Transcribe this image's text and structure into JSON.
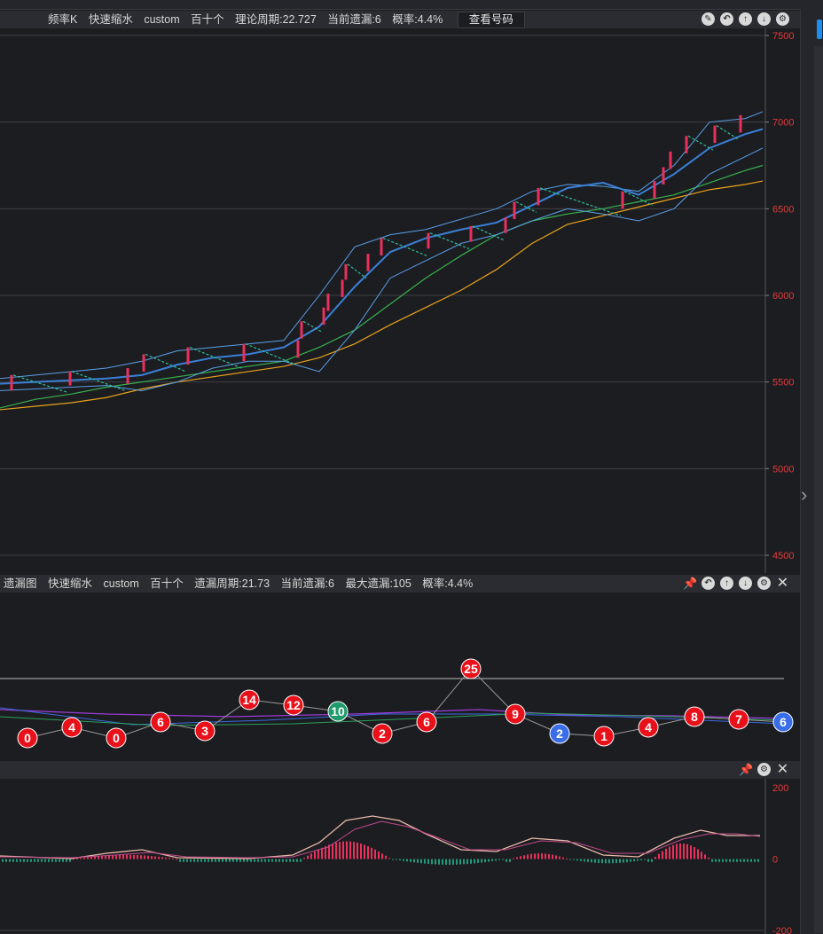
{
  "colors": {
    "bg": "#1c1d21",
    "bar": "#2b2c31",
    "up": "#e8315c",
    "axis": "#e23b3b",
    "boll": "#5aa0e8",
    "mid": "#3a80d8",
    "ma1": "#37b24d",
    "ma2": "#e8a21a",
    "bubble_red": "#e8111a",
    "bubble_blue": "#3a6ee8",
    "bubble_green": "#1f9a6a"
  },
  "top_bar": {
    "items": [
      "频率K",
      "快速缩水",
      "custom",
      "百十个",
      "理论周期:22.727",
      "当前遗漏:6",
      "概率:4.4%"
    ],
    "button": "查看号码",
    "icons": [
      "edit-icon",
      "undo-icon",
      "up-icon",
      "down-icon",
      "settings-icon"
    ]
  },
  "mid_bar": {
    "items": [
      "遗漏图",
      "快速缩水",
      "custom",
      "百十个",
      "遗漏周期:21.73",
      "当前遗漏:6",
      "最大遗漏:105",
      "概率:4.4%"
    ],
    "icons": [
      "pin-icon",
      "undo-icon",
      "up-icon",
      "down-icon",
      "settings-icon",
      "close-icon"
    ]
  },
  "bot_bar": {
    "icons": [
      "pin-icon",
      "settings-icon",
      "close-icon"
    ]
  },
  "chart_data": [
    {
      "type": "line",
      "name": "price",
      "y_ticks": [
        7500,
        7000,
        6500,
        6000,
        5500,
        5000,
        4500
      ],
      "ylim": [
        4500,
        7500
      ],
      "x": [
        0,
        40,
        80,
        120,
        160,
        200,
        240,
        280,
        320,
        360,
        400,
        440,
        480,
        520,
        560,
        600,
        640,
        680,
        720,
        760,
        800,
        840,
        860
      ],
      "mid": [
        5490,
        5500,
        5510,
        5520,
        5540,
        5600,
        5640,
        5660,
        5700,
        5820,
        6050,
        6250,
        6330,
        6380,
        6420,
        6520,
        6620,
        6650,
        6580,
        6700,
        6850,
        6930,
        6960
      ],
      "upper": [
        5520,
        5540,
        5560,
        5580,
        5620,
        5680,
        5700,
        5720,
        5740,
        6000,
        6280,
        6350,
        6380,
        6440,
        6500,
        6600,
        6640,
        6630,
        6600,
        6750,
        7000,
        7020,
        7060
      ],
      "lower": [
        5450,
        5460,
        5470,
        5480,
        5450,
        5500,
        5580,
        5620,
        5620,
        5560,
        5800,
        6100,
        6200,
        6300,
        6350,
        6430,
        6500,
        6470,
        6430,
        6500,
        6700,
        6800,
        6850
      ],
      "ma_green": [
        5350,
        5400,
        5430,
        5470,
        5500,
        5530,
        5560,
        5590,
        5620,
        5700,
        5800,
        5950,
        6100,
        6230,
        6350,
        6430,
        6470,
        6500,
        6540,
        6580,
        6650,
        6720,
        6750
      ],
      "ma_orange": [
        5340,
        5360,
        5380,
        5410,
        5460,
        5500,
        5530,
        5560,
        5590,
        5640,
        5720,
        5830,
        5930,
        6030,
        6150,
        6300,
        6410,
        6460,
        6510,
        6560,
        6610,
        6640,
        6660
      ],
      "candles": [
        {
          "x": 13,
          "open": 5450,
          "close": 5540
        },
        {
          "x": 79,
          "open": 5480,
          "close": 5560
        },
        {
          "x": 144,
          "open": 5490,
          "close": 5580
        },
        {
          "x": 162,
          "open": 5560,
          "close": 5660
        },
        {
          "x": 212,
          "open": 5600,
          "close": 5700
        },
        {
          "x": 275,
          "open": 5620,
          "close": 5720
        },
        {
          "x": 336,
          "open": 5640,
          "close": 5740
        },
        {
          "x": 340,
          "open": 5750,
          "close": 5850
        },
        {
          "x": 365,
          "open": 5830,
          "close": 5930
        },
        {
          "x": 370,
          "open": 5910,
          "close": 6010
        },
        {
          "x": 386,
          "open": 5990,
          "close": 6090
        },
        {
          "x": 390,
          "open": 6090,
          "close": 6180
        },
        {
          "x": 415,
          "open": 6140,
          "close": 6240
        },
        {
          "x": 430,
          "open": 6230,
          "close": 6330
        },
        {
          "x": 483,
          "open": 6270,
          "close": 6360
        },
        {
          "x": 531,
          "open": 6310,
          "close": 6400
        },
        {
          "x": 570,
          "open": 6360,
          "close": 6450
        },
        {
          "x": 580,
          "open": 6440,
          "close": 6540
        },
        {
          "x": 607,
          "open": 6520,
          "close": 6620
        },
        {
          "x": 702,
          "open": 6500,
          "close": 6600
        },
        {
          "x": 738,
          "open": 6560,
          "close": 6660
        },
        {
          "x": 748,
          "open": 6640,
          "close": 6740
        },
        {
          "x": 756,
          "open": 6730,
          "close": 6830
        },
        {
          "x": 774,
          "open": 6820,
          "close": 6920
        },
        {
          "x": 806,
          "open": 6880,
          "close": 6980
        },
        {
          "x": 835,
          "open": 6940,
          "close": 7040
        }
      ]
    },
    {
      "type": "scatter",
      "name": "omission",
      "points": [
        {
          "x": 31,
          "value": "0",
          "color": "red",
          "y": 832
        },
        {
          "x": 81,
          "value": "4",
          "color": "red",
          "y": 820
        },
        {
          "x": 131,
          "value": "0",
          "color": "red",
          "y": 832
        },
        {
          "x": 181,
          "value": "6",
          "color": "red",
          "y": 814
        },
        {
          "x": 231,
          "value": "3",
          "color": "red",
          "y": 824
        },
        {
          "x": 281,
          "value": "14",
          "color": "red",
          "y": 789
        },
        {
          "x": 331,
          "value": "12",
          "color": "red",
          "y": 795
        },
        {
          "x": 381,
          "value": "10",
          "color": "green",
          "y": 802
        },
        {
          "x": 431,
          "value": "2",
          "color": "red",
          "y": 827
        },
        {
          "x": 481,
          "value": "6",
          "color": "red",
          "y": 814
        },
        {
          "x": 531,
          "value": "25",
          "color": "red",
          "y": 754
        },
        {
          "x": 581,
          "value": "9",
          "color": "red",
          "y": 805
        },
        {
          "x": 631,
          "value": "2",
          "color": "blue",
          "y": 827
        },
        {
          "x": 681,
          "value": "1",
          "color": "red",
          "y": 830
        },
        {
          "x": 731,
          "value": "4",
          "color": "red",
          "y": 820
        },
        {
          "x": 783,
          "value": "8",
          "color": "red",
          "y": 808
        },
        {
          "x": 833,
          "value": "7",
          "color": "red",
          "y": 811
        },
        {
          "x": 883,
          "value": "6",
          "color": "blue",
          "y": 814
        }
      ]
    },
    {
      "type": "bar",
      "name": "macd",
      "y_ticks": [
        200,
        0,
        -200
      ],
      "ylim": [
        -200,
        200
      ]
    }
  ]
}
